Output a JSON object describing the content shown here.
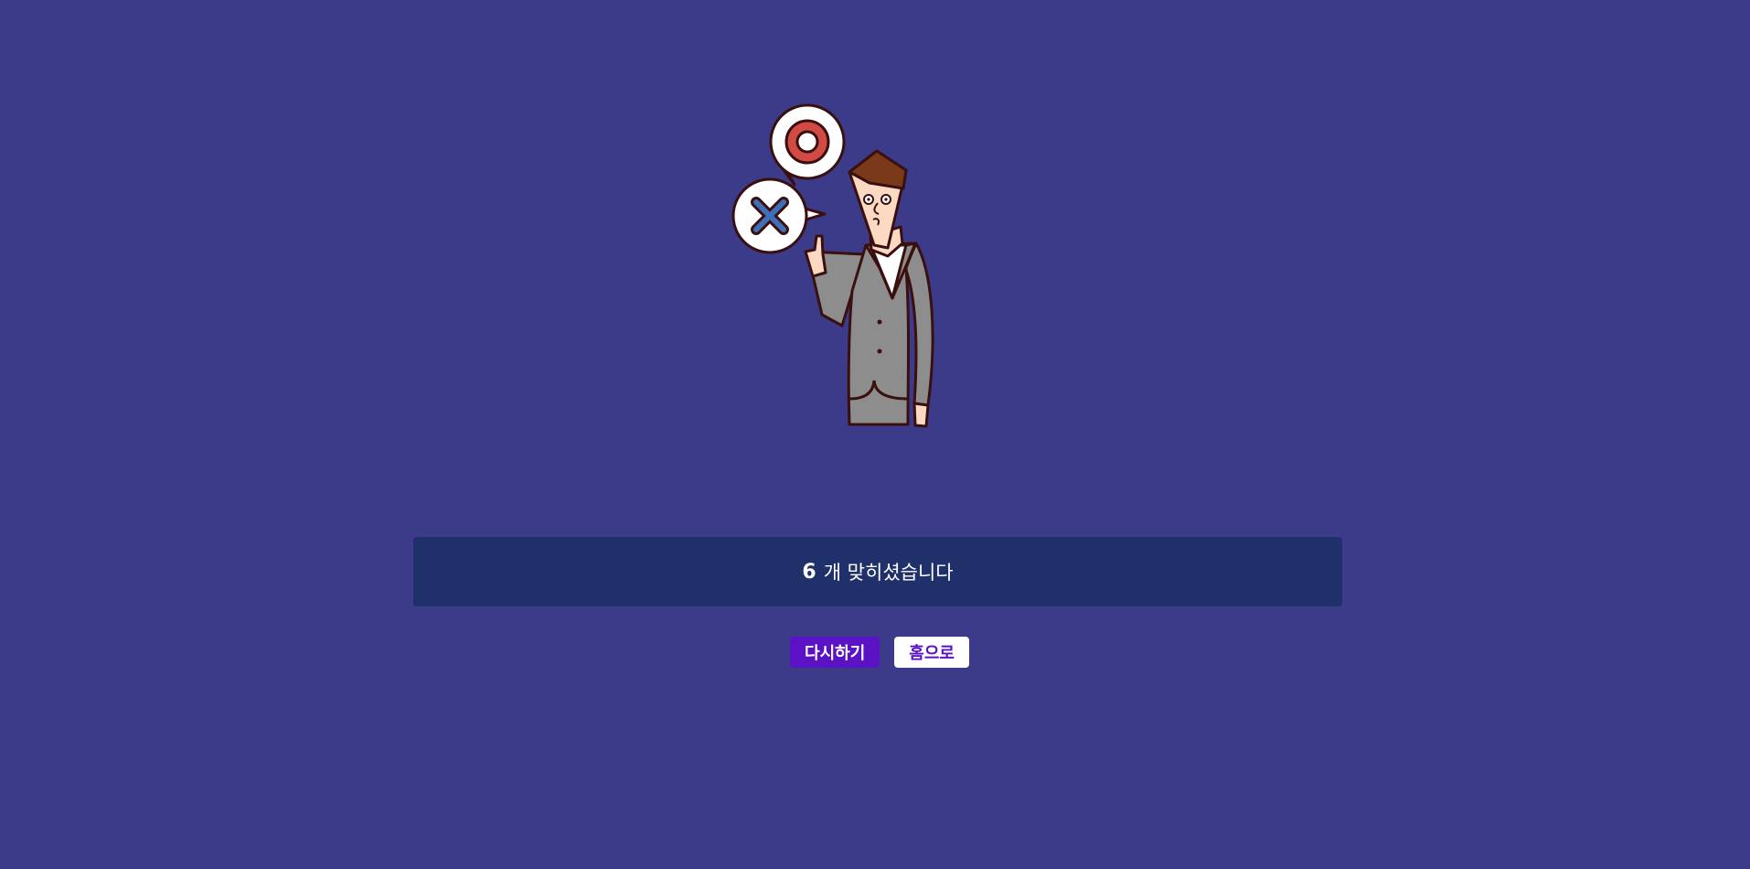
{
  "result": {
    "score": "6",
    "message": "개 맞히셨습니다"
  },
  "buttons": {
    "retry_label": "다시하기",
    "home_label": "홈으로"
  },
  "icons": {
    "illustration": "man-with-correct-incorrect-bubbles-icon",
    "correct": "circle-correct-icon",
    "incorrect": "cross-incorrect-icon"
  },
  "colors": {
    "background": "#3b3b8a",
    "result_box": "#20306a",
    "primary_button": "#5b12c4",
    "secondary_button": "#ffffff"
  }
}
